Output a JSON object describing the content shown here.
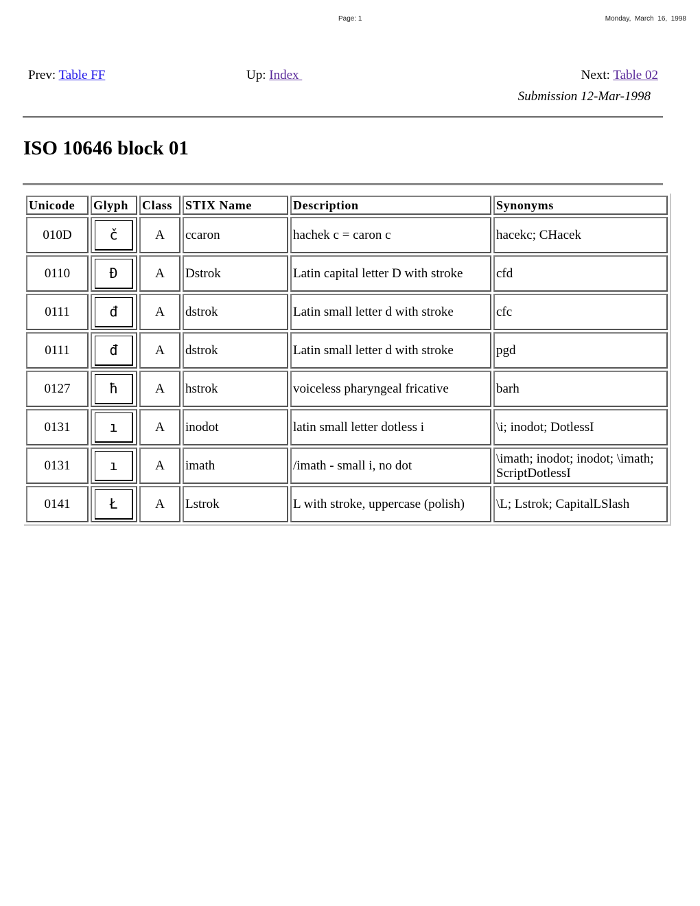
{
  "print_header": {
    "page": "Page: 1",
    "date": "Monday,  March  16,  1998"
  },
  "nav": {
    "prev_label": "Prev:",
    "prev_link": "Table FF",
    "up_label": "Up:",
    "up_link": "Index ",
    "next_label": "Next:",
    "next_link": "Table 02",
    "submission": "Submission 12-Mar-1998"
  },
  "title": "ISO 10646 block 01",
  "table": {
    "headers": [
      "Unicode",
      "Glyph",
      "Class",
      "STIX Name",
      "Description",
      "Synonyms"
    ],
    "rows": [
      {
        "unicode": "010D",
        "glyph": "č",
        "class": "A",
        "stix_name": "ccaron",
        "description": "hachek c = caron c",
        "synonyms": "hacekc; CHacek"
      },
      {
        "unicode": "0110",
        "glyph": "Đ",
        "class": "A",
        "stix_name": "Dstrok",
        "description": "Latin capital letter D with stroke",
        "synonyms": "cfd"
      },
      {
        "unicode": "0111",
        "glyph": "đ",
        "class": "A",
        "stix_name": "dstrok",
        "description": "Latin small letter d with stroke",
        "synonyms": "cfc"
      },
      {
        "unicode": "0111",
        "glyph": "đ",
        "class": "A",
        "stix_name": "dstrok",
        "description": "Latin small letter d with stroke",
        "synonyms": "pgd"
      },
      {
        "unicode": "0127",
        "glyph": "ħ",
        "class": "A",
        "stix_name": "hstrok",
        "description": "voiceless pharyngeal fricative",
        "synonyms": "barh"
      },
      {
        "unicode": "0131",
        "glyph": "ı",
        "class": "A",
        "stix_name": "inodot",
        "description": "latin small letter dotless i",
        "synonyms": "\\i; inodot; DotlessI"
      },
      {
        "unicode": "0131",
        "glyph": "ı",
        "class": "A",
        "stix_name": "imath",
        "description": "/imath - small i, no dot",
        "synonyms": "\\imath; inodot; inodot; \\imath; ScriptDotlessI"
      },
      {
        "unicode": "0141",
        "glyph": "Ł",
        "class": "A",
        "stix_name": "Lstrok",
        "description": "L with stroke, uppercase (polish)",
        "synonyms": "\\L; Lstrok; CapitalLSlash"
      }
    ]
  }
}
